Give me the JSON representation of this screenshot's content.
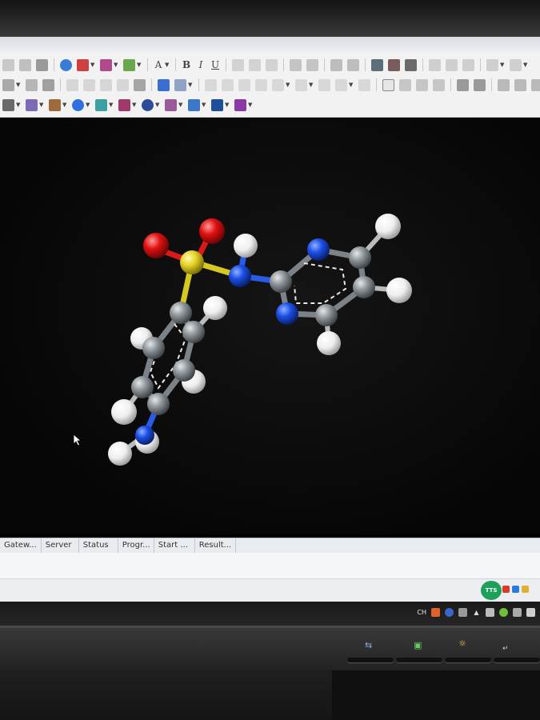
{
  "toolbar": {
    "font_letter": "A",
    "bold": "B",
    "italic": "I",
    "underline": "U"
  },
  "results_columns": [
    "Gatew...",
    "Server",
    "Status",
    "Progr...",
    "Start ...",
    "Result..."
  ],
  "tray": {
    "ime_label": "TTS",
    "language": "CH"
  },
  "icons": {
    "cursor": "mouse-pointer-icon",
    "monitor_input": "input-source-icon",
    "monitor_menu": "menu-icon",
    "monitor_brightness": "brightness-icon",
    "monitor_enter": "enter-icon"
  },
  "colors": {
    "background": "#000000",
    "carbon": "#8f9599",
    "hydrogen": "#eeeeee",
    "nitrogen": "#1c4fe6",
    "oxygen": "#e01010",
    "sulfur": "#e6d428"
  }
}
